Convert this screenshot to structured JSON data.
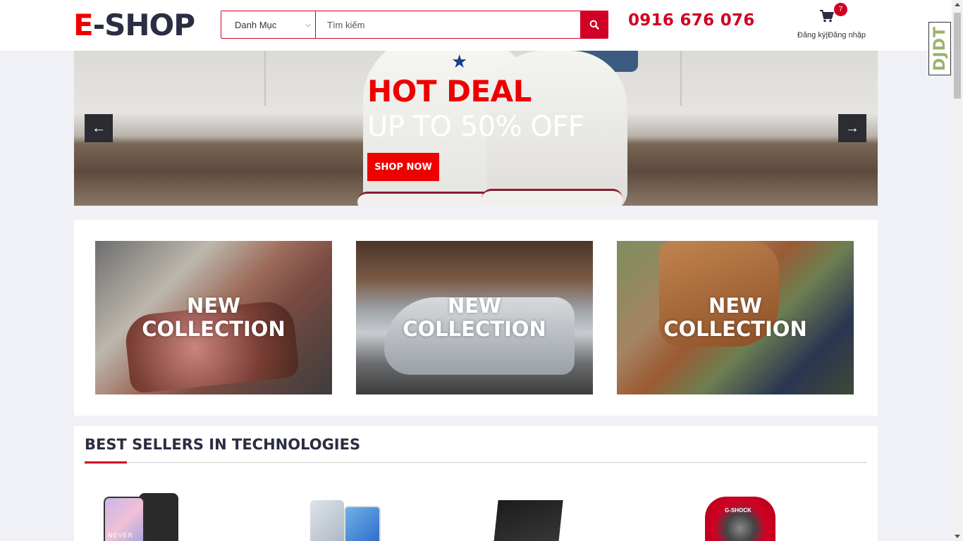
{
  "header": {
    "logo_accent": "E",
    "logo_rest": "-SHOP",
    "category_label": "Danh Mục",
    "search_placeholder": "Tìm kiếm",
    "phone": "0916 676 076",
    "cart_count": "7",
    "auth_text": "Đăng ký|Đăng nhập"
  },
  "hero": {
    "title": "HOT DEAL",
    "subtitle": "UP TO 50% OFF",
    "button_label": "SHOP NOW",
    "prev_arrow": "←",
    "next_arrow": "→"
  },
  "collections": [
    {
      "label_line1": "NEW",
      "label_line2": "COLLECTION"
    },
    {
      "label_line1": "NEW",
      "label_line2": "COLLECTION"
    },
    {
      "label_line1": "NEW",
      "label_line2": "COLLECTION"
    }
  ],
  "bestsellers": {
    "title": "BEST SELLERS IN TECHNOLOGIES",
    "products": [
      {
        "print": "NEVER"
      },
      {
        "print": ""
      },
      {
        "print": ""
      },
      {
        "print": "G-SHOCK"
      }
    ]
  },
  "extension_badge": "DJDT",
  "colors": {
    "accent": "#d10024",
    "hero_title": "#ee0000",
    "dark": "#2b2d42"
  },
  "icons": {
    "search": "search-icon",
    "cart": "cart-icon",
    "prev": "arrow-left-icon",
    "next": "arrow-right-icon"
  }
}
